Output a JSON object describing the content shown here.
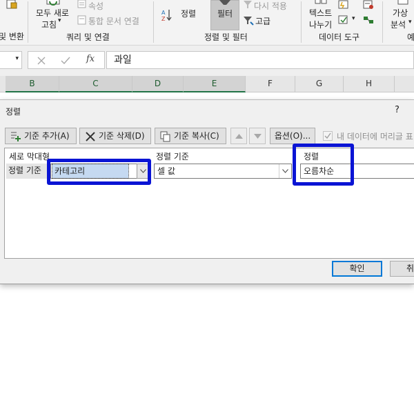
{
  "ribbon": {
    "refresh_all_line1": "모두 새로",
    "refresh_all_line2": "고침",
    "properties": "속성",
    "edit_links": "통합 문서 연결",
    "sort": "정렬",
    "filter": "필터",
    "reapply": "다시 적용",
    "advanced": "고급",
    "text_to_columns_line1": "텍스트",
    "text_to_columns_line2": "나누기",
    "whatif_line1": "가상",
    "whatif_line2": "분석",
    "group_left_partial": "및 변환",
    "group_queries": "쿼리 및 연결",
    "group_sort_filter": "정렬 및 필터",
    "group_data_tools": "데이터 도구",
    "group_right_partial": "예"
  },
  "formula_bar": {
    "cancel_icon": "x-icon",
    "enter_icon": "check-icon",
    "fx_label": "fx",
    "value": "과일"
  },
  "columns": [
    "B",
    "C",
    "D",
    "E",
    "F",
    "G",
    "H"
  ],
  "dialog": {
    "title": "정렬",
    "help": "?",
    "add_level": "기준 추가(A)",
    "delete_level": "기준 삭제(D)",
    "copy_level": "기준 복사(C)",
    "options": "옵션(O)...",
    "header_checkbox_label": "내 데이터에 머리글 표",
    "headers": {
      "column": "세로 막대형",
      "sort_on": "정렬 기준",
      "order": "정렬"
    },
    "row": {
      "label": "정렬 기준",
      "column_value": "카테고리",
      "sort_on_value": "셀 값",
      "order_value": "오름차순"
    },
    "ok": "확인",
    "cancel": "취소"
  },
  "colors": {
    "highlight": "#0a14d4",
    "excel_green": "#217346",
    "selection_blue": "#c5d9f1"
  }
}
